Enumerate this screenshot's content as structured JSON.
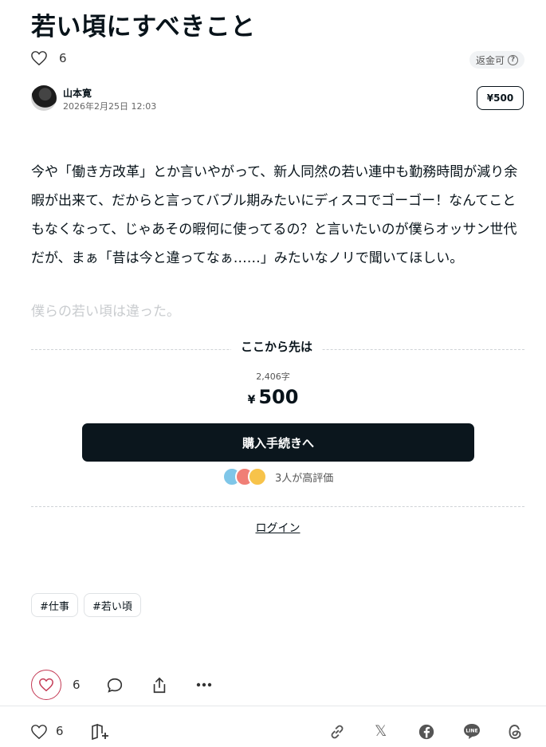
{
  "article": {
    "title": "若い頃にすべきこと",
    "like_count": "6",
    "refund_label": "返金可",
    "author_name": "山本寛",
    "date": "2026年2月25日 12:03",
    "price_button": "¥500",
    "body_paragraph": "今や「働き方改革」とか言いやがって、新人同然の若い連中も勤務時間が減り余暇が出来て、だからと言ってバブル期みたいにディスコでゴーゴー！なんてこともなくなって、じゃあその暇何に使ってるの？と言いたいのが僕らオッサン世代だが、まぁ「昔は今と違ってなぁ……」みたいなノリで聞いてほしい。",
    "faded_line": "僕らの若い頃は違った。"
  },
  "paywall": {
    "heading": "ここから先は",
    "char_count": "2,406字",
    "yen_symbol": "¥",
    "price": "500",
    "buy_button": "購入手続きへ",
    "rating_text": "3人が高評価",
    "login_link": "ログイン"
  },
  "tags": [
    "#仕事",
    "#若い頃"
  ],
  "actions": {
    "like_count": "6"
  },
  "bottom_bar": {
    "like_count": "6"
  },
  "colors": {
    "text": "#08131a",
    "button_dark": "#0b161d",
    "like_accent": "#c43a55"
  }
}
